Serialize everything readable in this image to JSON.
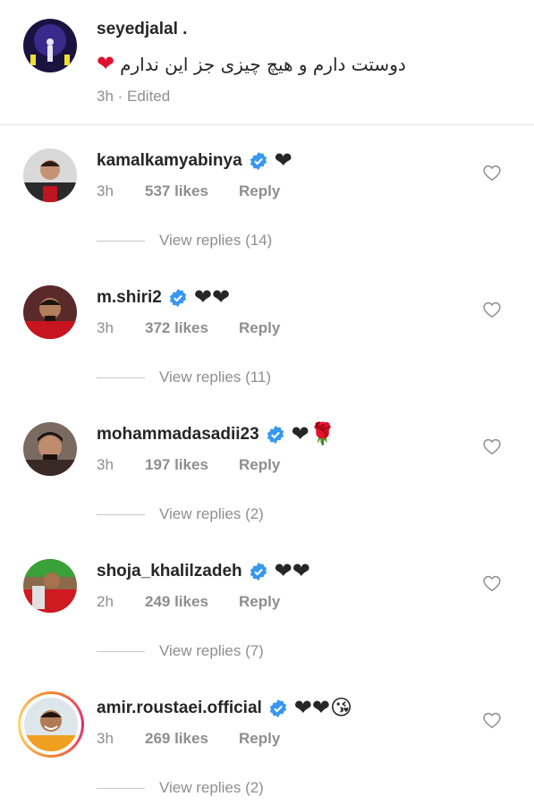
{
  "caption": {
    "username": "seyedjalal .",
    "text": "دوستت دارم و هیچ چیزی جز این ندارم",
    "emoji": "❤",
    "meta": "3h · Edited"
  },
  "comments": [
    {
      "username": "kamalkamyabinya",
      "emojis": "❤",
      "time": "3h",
      "likes": "537 likes",
      "reply": "Reply",
      "view_replies": "View replies (14)"
    },
    {
      "username": "m.shiri2",
      "emojis": "❤❤",
      "time": "3h",
      "likes": "372 likes",
      "reply": "Reply",
      "view_replies": "View replies (11)"
    },
    {
      "username": "mohammadasadii23",
      "emojis": "❤🌹",
      "time": "3h",
      "likes": "197 likes",
      "reply": "Reply",
      "view_replies": "View replies (2)"
    },
    {
      "username": "shoja_khalilzadeh",
      "emojis": "❤❤",
      "time": "2h",
      "likes": "249 likes",
      "reply": "Reply",
      "view_replies": "View replies (7)"
    },
    {
      "username": "amir.roustaei.official",
      "emojis": "❤❤😘",
      "time": "3h",
      "likes": "269 likes",
      "reply": "Reply",
      "view_replies": "View replies (2)"
    }
  ],
  "colors": {
    "verified": "#3897f0",
    "heart": "#e0102f",
    "meta_text": "#8e8e8e"
  },
  "icons": {
    "verified": "verified-badge-icon",
    "like": "heart-outline-icon"
  }
}
